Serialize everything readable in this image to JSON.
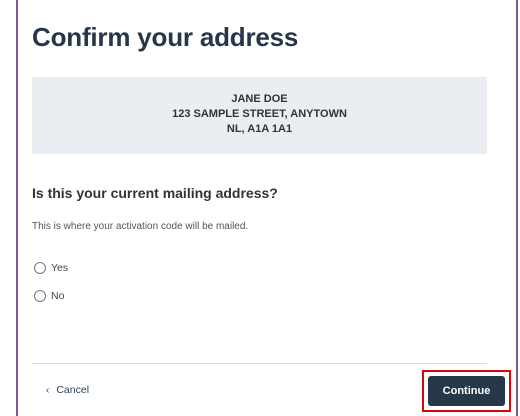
{
  "page": {
    "title": "Confirm your address"
  },
  "address": {
    "name": "JANE DOE",
    "street": "123 SAMPLE STREET, ANYTOWN",
    "province_postal": "NL, A1A 1A1"
  },
  "question": {
    "label": "Is this your current mailing address?",
    "hint": "This is where your activation code will be mailed.",
    "options": [
      "Yes",
      "No"
    ]
  },
  "footer": {
    "cancel_label": "Cancel",
    "cancel_icon": "chevron-left-icon",
    "continue_label": "Continue"
  },
  "colors": {
    "primary": "#26374a",
    "link": "#284162",
    "highlight": "#d3080c",
    "address_bg": "#eaedf1",
    "frame_border": "#7b5b9a"
  }
}
